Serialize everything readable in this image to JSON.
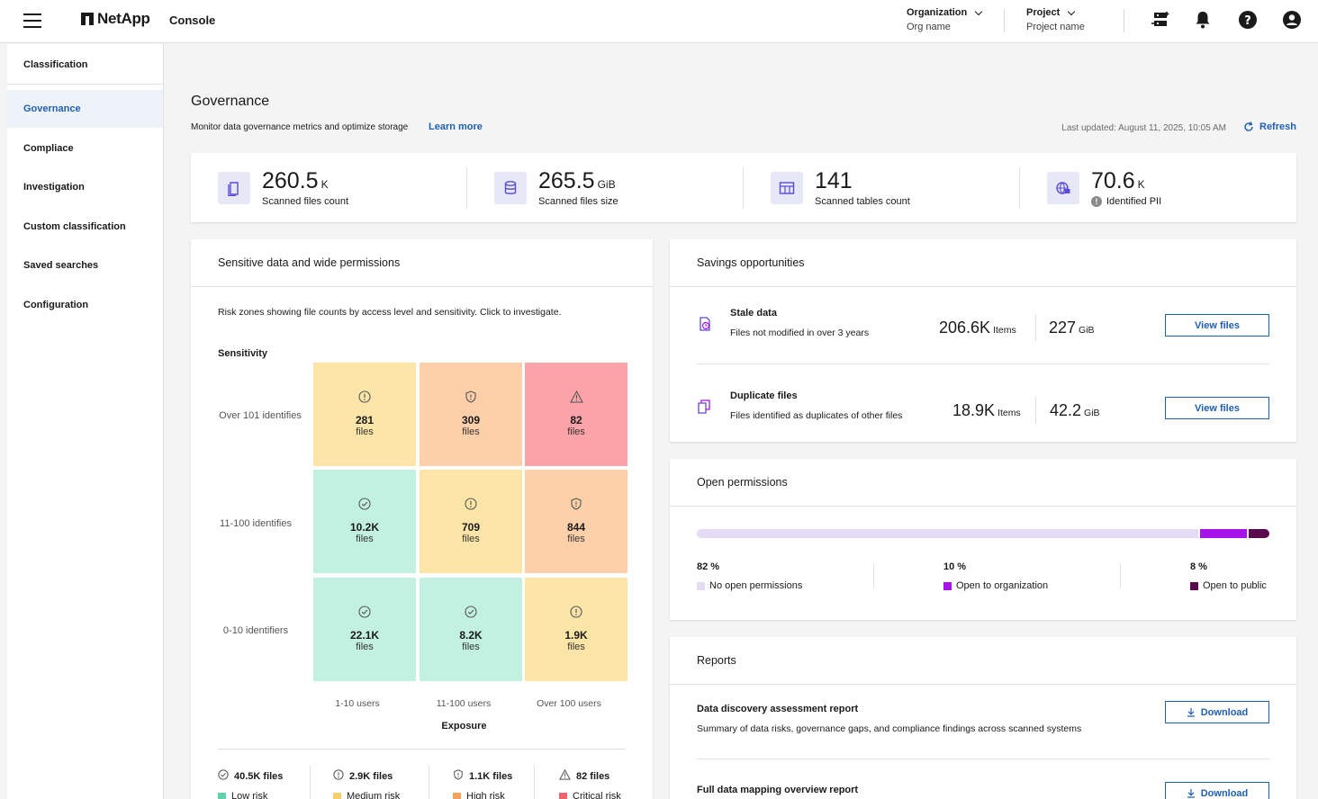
{
  "header": {
    "brand": "NetApp",
    "product": "Console",
    "organization": {
      "label": "Organization",
      "value": "Org name"
    },
    "project": {
      "label": "Project",
      "value": "Project name"
    }
  },
  "sidebar": {
    "items": [
      {
        "label": "Classification",
        "active": false
      },
      {
        "label": "Governance",
        "active": true
      },
      {
        "label": "Compliace",
        "active": false
      },
      {
        "label": "Investigation",
        "active": false
      },
      {
        "label": "Custom classification",
        "active": false
      },
      {
        "label": "Saved searches",
        "active": false
      },
      {
        "label": "Configuration",
        "active": false
      }
    ]
  },
  "page": {
    "title": "Governance",
    "subtitle": "Monitor data governance metrics and optimize storage",
    "learn_more": "Learn more",
    "last_updated": "Last updated: August 11, 2025, 10:05 AM",
    "refresh": "Refresh"
  },
  "stats": [
    {
      "value": "260.5",
      "unit": "K",
      "label": "Scanned files count",
      "icon": "files-icon"
    },
    {
      "value": "265.5",
      "unit": "GiB",
      "label": "Scanned files size",
      "icon": "database-icon"
    },
    {
      "value": "141",
      "unit": "",
      "label": "Scanned tables count",
      "icon": "table-icon"
    },
    {
      "value": "70.6",
      "unit": "K",
      "label": "Identified PII",
      "icon": "pii-icon"
    }
  ],
  "sensitive": {
    "title": "Sensitive data and wide permissions",
    "description": "Risk zones showing file counts by access level and sensitivity. Click to investigate.",
    "y_axis": "Sensitivity",
    "x_axis": "Exposure",
    "rows": [
      "Over 101 identifies",
      "11-100 identifies",
      "0-10 identifiers"
    ],
    "columns": [
      "1-10 users",
      "11-100 users",
      "Over 100 users"
    ],
    "files_word": "files",
    "cells": [
      [
        {
          "value": "281",
          "risk": "medium"
        },
        {
          "value": "309",
          "risk": "high"
        },
        {
          "value": "82",
          "risk": "critical"
        }
      ],
      [
        {
          "value": "10.2K",
          "risk": "low"
        },
        {
          "value": "709",
          "risk": "medium"
        },
        {
          "value": "844",
          "risk": "high"
        }
      ],
      [
        {
          "value": "22.1K",
          "risk": "low"
        },
        {
          "value": "8.2K",
          "risk": "low"
        },
        {
          "value": "1.9K",
          "risk": "medium"
        }
      ]
    ],
    "legend": [
      {
        "count": "40.5K files",
        "label": "Low risk",
        "risk": "low"
      },
      {
        "count": "2.9K files",
        "label": "Medium risk",
        "risk": "medium"
      },
      {
        "count": "1.1K files",
        "label": "High risk",
        "risk": "high"
      },
      {
        "count": "82 files",
        "label": "Critical risk",
        "risk": "critical"
      }
    ],
    "colors": {
      "low": {
        "fill": "#c2f0e1",
        "swatch": "#5fd3ae"
      },
      "medium": {
        "fill": "#fde5a7",
        "swatch": "#f6cf6a"
      },
      "high": {
        "fill": "#fdd0a9",
        "swatch": "#f5a25e"
      },
      "critical": {
        "fill": "#fba3a8",
        "swatch": "#f0646e"
      }
    }
  },
  "savings": {
    "title": "Savings opportunities",
    "items": [
      {
        "name": "Stale data",
        "description": "Files not modified in over 3 years",
        "count": "206.6K",
        "count_unit": "Items",
        "size": "227",
        "size_unit": "GiB",
        "button": "View files"
      },
      {
        "name": "Duplicate files",
        "description": "Files identified as duplicates of other files",
        "count": "18.9K",
        "count_unit": "Items",
        "size": "42.2",
        "size_unit": "GiB",
        "button": "View files"
      }
    ]
  },
  "permissions": {
    "title": "Open permissions",
    "segments": [
      {
        "percent_label": "82 %",
        "label": "No open permissions",
        "fraction": 0.875,
        "color": "#e4dcf5"
      },
      {
        "percent_label": "10 %",
        "label": "Open to organization",
        "fraction": 0.085,
        "color": "#a712e8"
      },
      {
        "percent_label": "8 %",
        "label": "Open to public",
        "fraction": 0.04,
        "color": "#5c0a4f"
      }
    ]
  },
  "reports": {
    "title": "Reports",
    "items": [
      {
        "name": "Data discovery assessment report",
        "description": "Summary of data risks, governance gaps, and compliance findings across scanned systems",
        "button": "Download"
      },
      {
        "name": "Full data mapping overview report",
        "description": "",
        "button": "Download"
      }
    ]
  }
}
